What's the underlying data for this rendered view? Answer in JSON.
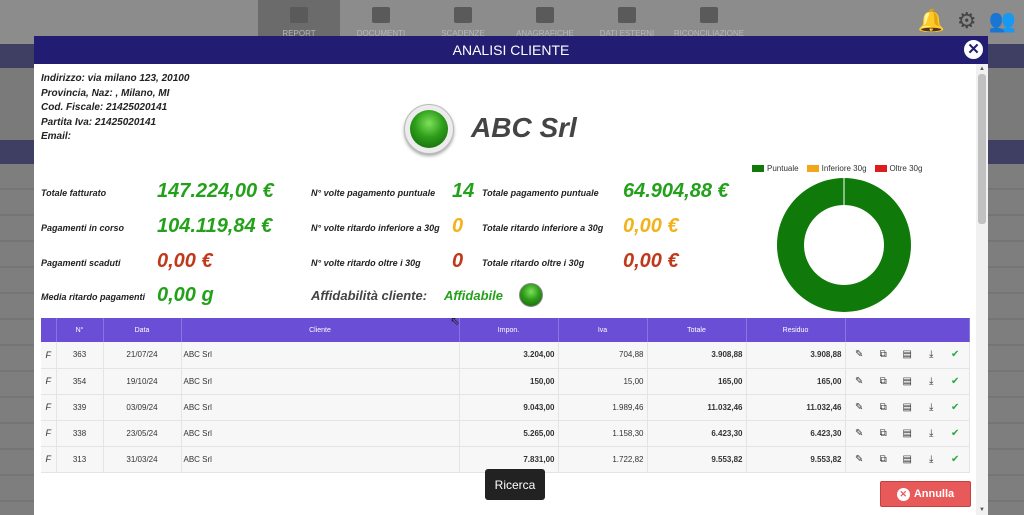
{
  "background": {
    "nav": [
      {
        "label": "REPORT",
        "icon": "monitor-icon"
      },
      {
        "label": "DOCUMENTI",
        "icon": "document-icon"
      },
      {
        "label": "SCADENZE",
        "icon": "calendar-icon"
      },
      {
        "label": "ANAGRAFICHE",
        "icon": "users-icon"
      },
      {
        "label": "DATI ESTERNI",
        "icon": "undo-icon"
      },
      {
        "label": "RICONCILIAZIONE",
        "icon": "money-icon"
      }
    ]
  },
  "modal": {
    "title": "ANALISI CLIENTE",
    "close_icon": "close-icon",
    "address": {
      "indirizzo": "Indirizzo:  via milano 123, 20100",
      "provincia": "Provincia, Naz:  , Milano, MI",
      "cod_fiscale": "Cod. Fiscale:  21425020141",
      "partita_iva": "Partita Iva:  21425020141",
      "email": "Email:"
    },
    "company_name": "ABC Srl",
    "stats": {
      "totale_fatturato_label": "Totale fatturato",
      "totale_fatturato": "147.224,00 €",
      "pagamenti_corso_label": "Pagamenti in corso",
      "pagamenti_corso": "104.119,84 €",
      "pagamenti_scaduti_label": "Pagamenti scaduti",
      "pagamenti_scaduti": "0,00 €",
      "media_ritardo_label": "Media ritardo pagamenti",
      "media_ritardo": "0,00 g",
      "volte_puntuale_label": "N° volte pagamento puntuale",
      "volte_puntuale": "14",
      "volte_ritardo_inf_label": "N° volte ritardo inferiore a 30g",
      "volte_ritardo_inf": "0",
      "volte_ritardo_oltre_label": "N° volte ritardo oltre i 30g",
      "volte_ritardo_oltre": "0",
      "tot_puntuale_label": "Totale pagamento puntuale",
      "tot_puntuale": "64.904,88 €",
      "tot_ritardo_inf_label": "Totale ritardo inferiore a 30g",
      "tot_ritardo_inf": "0,00 €",
      "tot_ritardo_oltre_label": "Totale ritardo oltre i 30g",
      "tot_ritardo_oltre": "0,00 €",
      "affidabilita_label": "Affidabilità cliente:",
      "affidabilita": "Affidabile"
    },
    "chart_data": {
      "type": "pie",
      "legend_position": "top",
      "series": [
        {
          "name": "Puntuale",
          "value": 64904.88,
          "color": "#0f7a0a"
        },
        {
          "name": "Inferiore 30g",
          "value": 0,
          "color": "#f2a61b"
        },
        {
          "name": "Oltre 30g",
          "value": 0,
          "color": "#e01b1b"
        }
      ]
    },
    "table": {
      "headers": [
        "",
        "N°",
        "Data",
        "Cliente",
        "Impon.",
        "Iva",
        "Totale",
        "Residuo",
        ""
      ],
      "rows": [
        {
          "tipo": "F",
          "num": "363",
          "data": "21/07/24",
          "cliente": "ABC Srl",
          "impon": "3.204,00",
          "iva": "704,88",
          "totale": "3.908,88",
          "residuo": "3.908,88"
        },
        {
          "tipo": "F",
          "num": "354",
          "data": "19/10/24",
          "cliente": "ABC Srl",
          "impon": "150,00",
          "iva": "15,00",
          "totale": "165,00",
          "residuo": "165,00"
        },
        {
          "tipo": "F",
          "num": "339",
          "data": "03/09/24",
          "cliente": "ABC Srl",
          "impon": "9.043,00",
          "iva": "1.989,46",
          "totale": "11.032,46",
          "residuo": "11.032,46"
        },
        {
          "tipo": "F",
          "num": "338",
          "data": "23/05/24",
          "cliente": "ABC Srl",
          "impon": "5.265,00",
          "iva": "1.158,30",
          "totale": "6.423,30",
          "residuo": "6.423,30"
        },
        {
          "tipo": "F",
          "num": "313",
          "data": "31/03/24",
          "cliente": "ABC Srl",
          "impon": "7.831,00",
          "iva": "1.722,82",
          "totale": "9.553,82",
          "residuo": "9.553,82"
        }
      ],
      "row_actions": [
        "pencil-icon",
        "copy-icon",
        "pdf-icon",
        "download-icon",
        "check-circle-icon"
      ]
    },
    "tooltip": "Ricerca",
    "cancel_label": "Annulla"
  }
}
